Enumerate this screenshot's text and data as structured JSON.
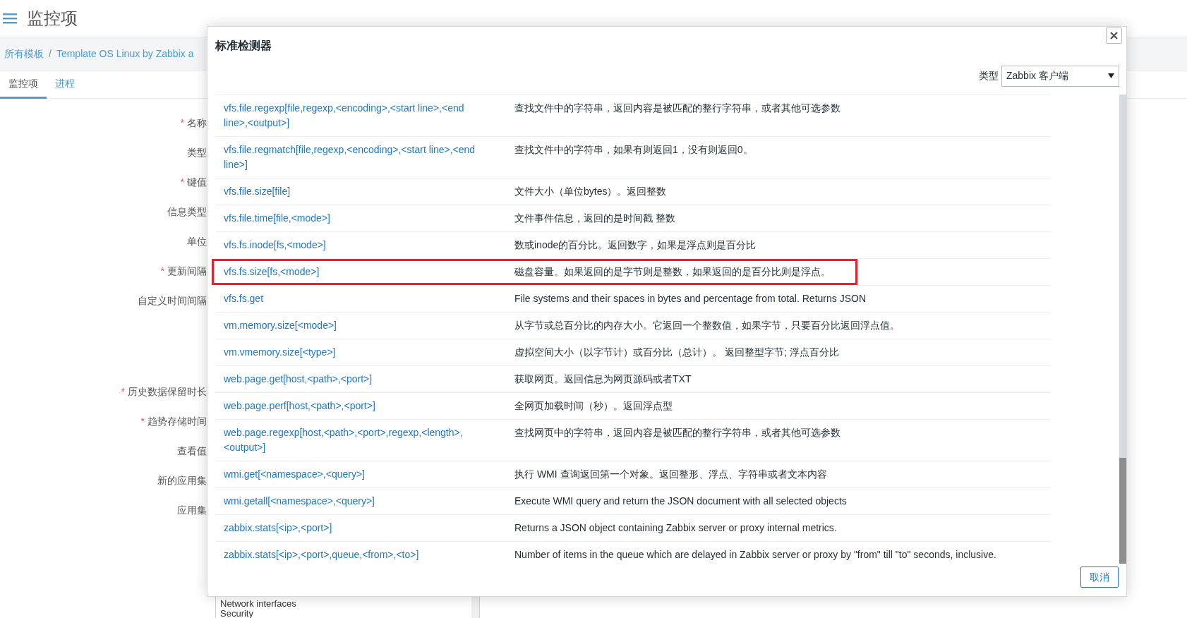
{
  "page": {
    "title": "监控项"
  },
  "breadcrumb": {
    "separator": "/",
    "items": [
      {
        "label": "所有模板"
      },
      {
        "label": "Template OS Linux by Zabbix a"
      }
    ]
  },
  "tabs": [
    {
      "label": "监控项",
      "selected": true
    },
    {
      "label": "进程",
      "selected": false
    }
  ],
  "required_mark": "*",
  "form_fields": [
    {
      "label": "名称",
      "required": true,
      "kind": "field"
    },
    {
      "label": "类型",
      "required": false,
      "kind": "field"
    },
    {
      "label": "键值",
      "required": true,
      "kind": "field"
    },
    {
      "label": "信息类型",
      "required": false,
      "kind": "field"
    },
    {
      "label": "单位",
      "required": false,
      "kind": "field"
    },
    {
      "label": "更新间隔",
      "required": true,
      "kind": "field"
    },
    {
      "label": "自定义时间间隔",
      "required": false,
      "kind": "table"
    },
    {
      "label": "历史数据保留时长",
      "required": true,
      "kind": "field"
    },
    {
      "label": "趋势存储时间",
      "required": true,
      "kind": "field"
    },
    {
      "label": "查看值",
      "required": false,
      "kind": "field"
    },
    {
      "label": "新的应用集",
      "required": false,
      "kind": "field"
    },
    {
      "label": "应用集",
      "required": false,
      "kind": "listbox",
      "options": [
        "Network interfaces",
        "Security"
      ]
    }
  ],
  "dialog": {
    "title": "标准检测器",
    "type_label": "类型",
    "type_value": "Zabbix 客户端",
    "cancel_button": "取消",
    "rows": [
      {
        "key": "vfs.file.regexp[file,regexp,<encoding>,<start line>,<end line>,<output>]",
        "description": "查找文件中的字符串，返回内容是被匹配的整行字符串，或者其他可选参数",
        "highlighted": false
      },
      {
        "key": "vfs.file.regmatch[file,regexp,<encoding>,<start line>,<end line>]",
        "description": "查找文件中的字符串，如果有则返回1，没有则返回0。",
        "highlighted": false
      },
      {
        "key": "vfs.file.size[file]",
        "description": "文件大小（单位bytes）。返回整数",
        "highlighted": false
      },
      {
        "key": "vfs.file.time[file,<mode>]",
        "description": "文件事件信息，返回的是时间戳 整数",
        "highlighted": false
      },
      {
        "key": "vfs.fs.inode[fs,<mode>]",
        "description": "数或inode的百分比。返回数字，如果是浮点则是百分比",
        "highlighted": false
      },
      {
        "key": "vfs.fs.size[fs,<mode>]",
        "description": "磁盘容量。如果返回的是字节则是整数，如果返回的是百分比则是浮点。",
        "highlighted": true
      },
      {
        "key": "vfs.fs.get",
        "description": "File systems and their spaces in bytes and percentage from total. Returns JSON",
        "highlighted": false
      },
      {
        "key": "vm.memory.size[<mode>]",
        "description": "从字节或总百分比的内存大小。它返回一个整数值，如果字节，只要百分比返回浮点值。",
        "highlighted": false
      },
      {
        "key": "vm.vmemory.size[<type>]",
        "description": "虚拟空间大小（以字节计）或百分比（总计）。 返回整型字节; 浮点百分比",
        "highlighted": false
      },
      {
        "key": "web.page.get[host,<path>,<port>]",
        "description": "获取网页。返回信息为网页源码或者TXT",
        "highlighted": false
      },
      {
        "key": "web.page.perf[host,<path>,<port>]",
        "description": "全网页加载时间（秒）。返回浮点型",
        "highlighted": false
      },
      {
        "key": "web.page.regexp[host,<path>,<port>,regexp,<length>,<output>]",
        "description": "查找网页中的字符串，返回内容是被匹配的整行字符串，或者其他可选参数",
        "highlighted": false
      },
      {
        "key": "wmi.get[<namespace>,<query>]",
        "description": "执行 WMI 查询返回第一个对象。返回整形、浮点、字符串或者文本内容",
        "highlighted": false
      },
      {
        "key": "wmi.getall[<namespace>,<query>]",
        "description": "Execute WMI query and return the JSON document with all selected objects",
        "highlighted": false
      },
      {
        "key": "zabbix.stats[<ip>,<port>]",
        "description": "Returns a JSON object containing Zabbix server or proxy internal metrics.",
        "highlighted": false
      },
      {
        "key": "zabbix.stats[<ip>,<port>,queue,<from>,<to>]",
        "description": "Number of items in the queue which are delayed in Zabbix server or proxy by \"from\" till \"to\" seconds, inclusive.",
        "highlighted": false
      }
    ]
  }
}
